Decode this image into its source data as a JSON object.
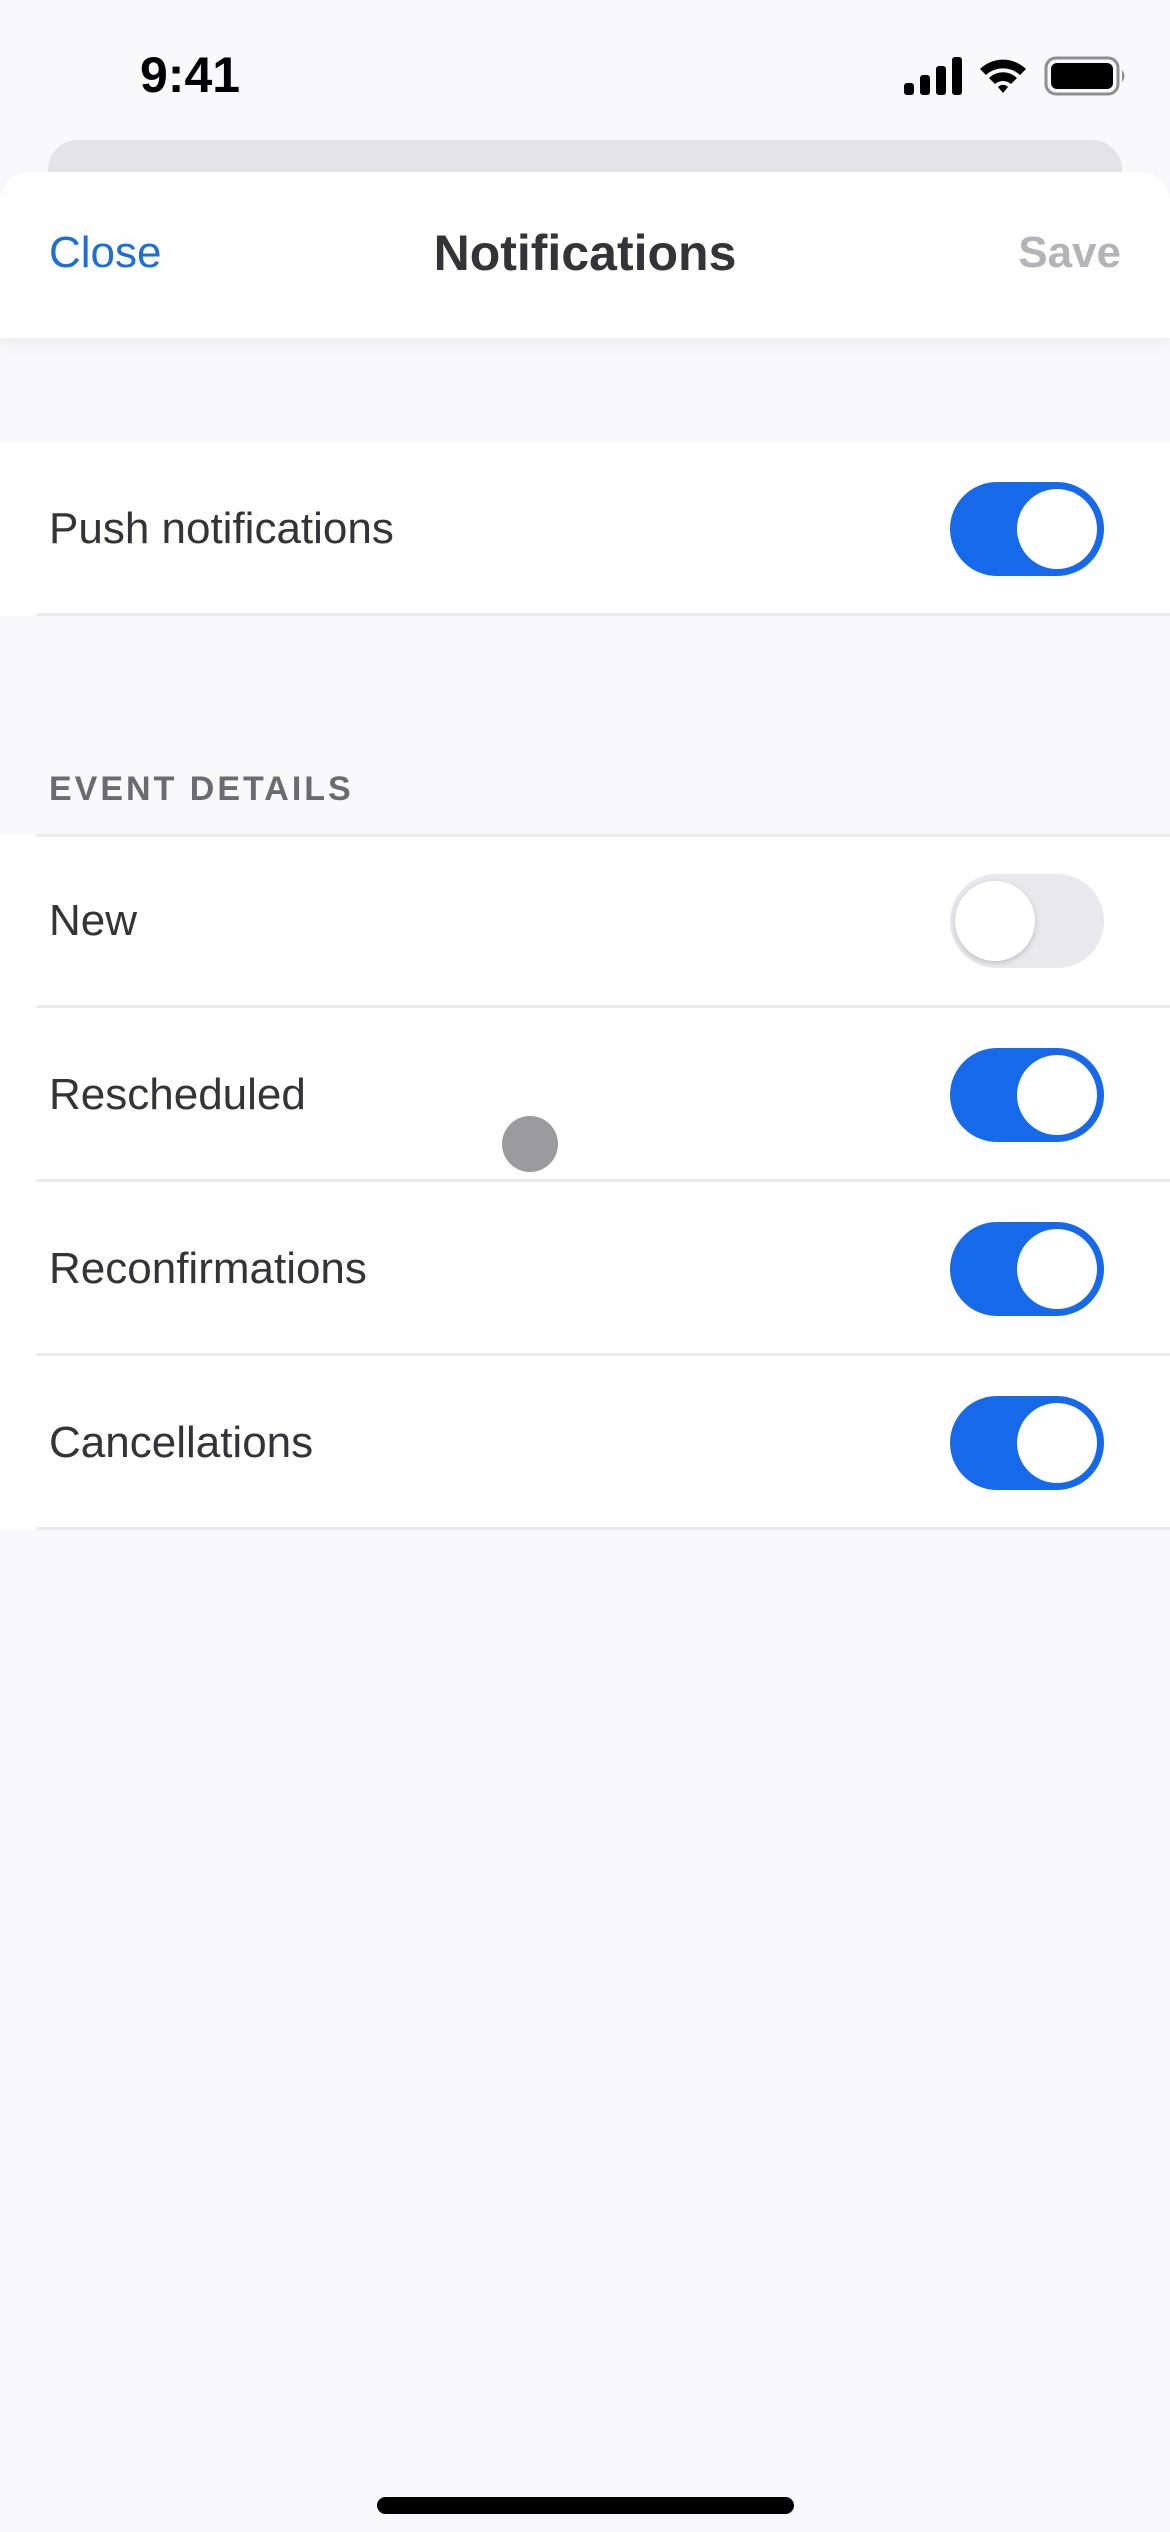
{
  "status_bar": {
    "time": "9:41",
    "icons": [
      "cellular-signal-icon",
      "wifi-icon",
      "battery-icon"
    ]
  },
  "header": {
    "close_label": "Close",
    "title": "Notifications",
    "save_label": "Save",
    "save_enabled": false
  },
  "colors": {
    "accent": "#1669e8",
    "link": "#1b6fd6",
    "disabled": "#b4b3b8",
    "toggle_off": "#e9e8ec",
    "background": "#f9f8fb"
  },
  "push": {
    "label": "Push notifications",
    "enabled": true
  },
  "event_details": {
    "section_title": "EVENT DETAILS",
    "items": [
      {
        "label": "New",
        "enabled": false
      },
      {
        "label": "Rescheduled",
        "enabled": true
      },
      {
        "label": "Reconfirmations",
        "enabled": true
      },
      {
        "label": "Cancellations",
        "enabled": true
      }
    ]
  }
}
